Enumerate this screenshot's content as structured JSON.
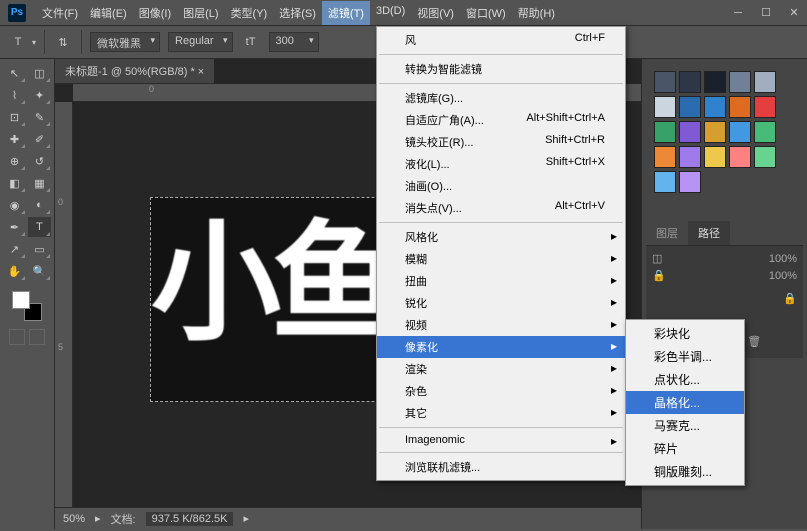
{
  "app": {
    "logo_text": "Ps"
  },
  "menubar": [
    "文件(F)",
    "编辑(E)",
    "图像(I)",
    "图层(L)",
    "类型(Y)",
    "选择(S)",
    "滤镜(T)",
    "3D(D)",
    "视图(V)",
    "窗口(W)",
    "帮助(H)"
  ],
  "active_menu_index": 6,
  "options": {
    "font": "微软雅黑",
    "weight": "Regular",
    "size_icon": "tT",
    "size": "300"
  },
  "doc_tab": "未标题-1 @ 50%(RGB/8) * ×",
  "ruler_h": [
    "0"
  ],
  "ruler_v": [
    "0",
    "5"
  ],
  "canvas_text": "小鱼",
  "status": {
    "zoom": "50%",
    "docinfo_label": "文档:",
    "docinfo": "937.5 K/862.5K"
  },
  "filter_menu": [
    {
      "label": "风",
      "shortcut": "Ctrl+F",
      "type": "item"
    },
    {
      "type": "sep"
    },
    {
      "label": "转换为智能滤镜",
      "type": "item"
    },
    {
      "type": "sep"
    },
    {
      "label": "滤镜库(G)...",
      "type": "item"
    },
    {
      "label": "自适应广角(A)...",
      "shortcut": "Alt+Shift+Ctrl+A",
      "type": "item"
    },
    {
      "label": "镜头校正(R)...",
      "shortcut": "Shift+Ctrl+R",
      "type": "item"
    },
    {
      "label": "液化(L)...",
      "shortcut": "Shift+Ctrl+X",
      "type": "item"
    },
    {
      "label": "油画(O)...",
      "type": "item"
    },
    {
      "label": "消失点(V)...",
      "shortcut": "Alt+Ctrl+V",
      "type": "item"
    },
    {
      "type": "sep"
    },
    {
      "label": "风格化",
      "type": "sub"
    },
    {
      "label": "模糊",
      "type": "sub"
    },
    {
      "label": "扭曲",
      "type": "sub"
    },
    {
      "label": "锐化",
      "type": "sub"
    },
    {
      "label": "视频",
      "type": "sub"
    },
    {
      "label": "像素化",
      "type": "sub",
      "highlighted": true
    },
    {
      "label": "渲染",
      "type": "sub"
    },
    {
      "label": "杂色",
      "type": "sub"
    },
    {
      "label": "其它",
      "type": "sub"
    },
    {
      "type": "sep"
    },
    {
      "label": "Imagenomic",
      "type": "sub"
    },
    {
      "type": "sep"
    },
    {
      "label": "浏览联机滤镜...",
      "type": "item"
    }
  ],
  "submenu": [
    "彩块化",
    "彩色半调...",
    "点状化...",
    "晶格化...",
    "马赛克...",
    "碎片",
    "铜版雕刻..."
  ],
  "submenu_highlighted": 3,
  "panels": {
    "tabs": [
      "图层",
      "路径"
    ],
    "active_tab": 1,
    "opacity_label": "100%",
    "fill_label": "100%"
  },
  "swatch_colors": [
    "#4a5568",
    "#2d3748",
    "#1a202c",
    "#718096",
    "#a0aec0",
    "#cbd5e0",
    "#2b6cb0",
    "#3182ce",
    "#dd6b20",
    "#e53e3e",
    "#38a169",
    "#805ad5",
    "#d69e2e",
    "#4299e1",
    "#48bb78",
    "#ed8936",
    "#9f7aea",
    "#ecc94b",
    "#fc8181",
    "#68d391",
    "#63b3ed",
    "#b794f4"
  ]
}
